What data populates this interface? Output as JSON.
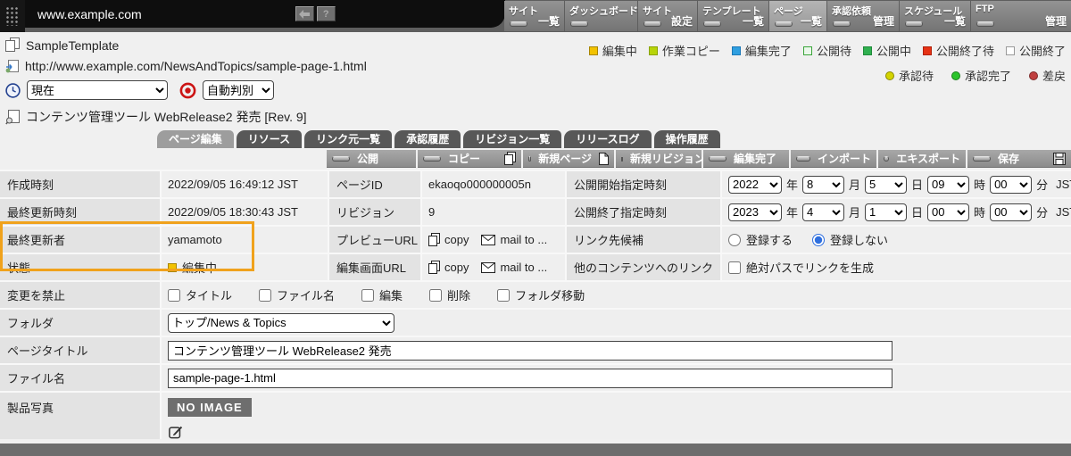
{
  "topbar": {
    "site": "www.example.com",
    "help_label": "?",
    "nav": [
      {
        "top": "サイト",
        "bottom": "一覧"
      },
      {
        "top": "ダッシュボード",
        "bottom": ""
      },
      {
        "top": "サイト",
        "bottom": "設定"
      },
      {
        "top": "テンプレート",
        "bottom": "一覧"
      },
      {
        "top": "ページ",
        "bottom": "一覧"
      },
      {
        "top": "承認依頼",
        "bottom": "管理"
      },
      {
        "top": "スケジュール",
        "bottom": "一覧"
      },
      {
        "top": "FTP",
        "bottom": "管理"
      }
    ]
  },
  "header": {
    "template_name": "SampleTemplate",
    "page_url": "http://www.example.com/NewsAndTopics/sample-page-1.html",
    "revision_select": "現在",
    "render_select": "自動判別",
    "page_heading": "コンテンツ管理ツール WebRelease2 発売 [Rev. 9]"
  },
  "legend": {
    "states": [
      {
        "label": "編集中",
        "fill": "#f2c200",
        "border": "#a88600"
      },
      {
        "label": "作業コピー",
        "fill": "#b8d409",
        "border": "#8aa300"
      },
      {
        "label": "編集完了",
        "fill": "#2f9fe0",
        "border": "#1b78b8"
      },
      {
        "label": "公開待",
        "fill": "#eaf7ea",
        "border": "#3aa53a"
      },
      {
        "label": "公開中",
        "fill": "#30b050",
        "border": "#1f8a3a"
      },
      {
        "label": "公開終了待",
        "fill": "#e63214",
        "border": "#b02008"
      },
      {
        "label": "公開終了",
        "fill": "#ffffff",
        "border": "#9a9a9a"
      }
    ],
    "approvals": [
      {
        "label": "承認待",
        "fill": "#d4d400"
      },
      {
        "label": "承認完了",
        "fill": "#2bc42b"
      },
      {
        "label": "差戻",
        "fill": "#c04040"
      }
    ]
  },
  "tabs": [
    {
      "label": "ページ編集"
    },
    {
      "label": "リソース"
    },
    {
      "label": "リンク元一覧"
    },
    {
      "label": "承認履歴"
    },
    {
      "label": "リビジョン一覧"
    },
    {
      "label": "リリースログ"
    },
    {
      "label": "操作履歴"
    }
  ],
  "toolbar": [
    {
      "label": "公開"
    },
    {
      "label": "コピー"
    },
    {
      "label": "新規ページ"
    },
    {
      "label": "新規リビジョン"
    },
    {
      "label": "編集完了"
    },
    {
      "label": "インポート"
    },
    {
      "label": "エキスポート"
    },
    {
      "label": "保存"
    }
  ],
  "form": {
    "created_label": "作成時刻",
    "created_value": "2022/09/05 16:49:12 JST",
    "pageid_label": "ページID",
    "pageid_value": "ekaoqo000000005n",
    "pub_start_label": "公開開始指定時刻",
    "pub_end_label": "公開終了指定時刻",
    "updated_label": "最終更新時刻",
    "updated_value": "2022/09/05 18:30:43 JST",
    "revision_label": "リビジョン",
    "revision_value": "9",
    "updater_label": "最終更新者",
    "updater_value": "yamamoto",
    "preview_url_label": "プレビューURL",
    "edit_url_label": "編集画面URL",
    "copy_text": "copy",
    "mail_text": "mail to ...",
    "link_cand_label": "リンク先候補",
    "register_yes": "登録する",
    "register_no": "登録しない",
    "status_label": "状態",
    "status_value": "編集中",
    "other_link_label": "他のコンテンツへのリンク",
    "abs_path_label": "絶対パスでリンクを生成",
    "forbid_label": "変更を禁止",
    "forbid_options": [
      "タイトル",
      "ファイル名",
      "編集",
      "削除",
      "フォルダ移動"
    ],
    "folder_label": "フォルダ",
    "folder_value": "トップ/News & Topics",
    "title_label": "ページタイトル",
    "title_value": "コンテンツ管理ツール WebRelease2 発売",
    "filename_label": "ファイル名",
    "filename_value": "sample-page-1.html",
    "photo_label": "製品写真",
    "no_image_text": "NO IMAGE",
    "date_units": {
      "year": "年",
      "month": "月",
      "day": "日",
      "hour": "時",
      "min": "分",
      "tz": "JST"
    },
    "pub_start": {
      "year": "2022",
      "month": "8",
      "day": "5",
      "hour": "09",
      "min": "00"
    },
    "pub_end": {
      "year": "2023",
      "month": "4",
      "day": "1",
      "hour": "00",
      "min": "00"
    }
  },
  "colors": {
    "highlight_border": "#f0a21c",
    "topbar_bg": "#5e5e5e",
    "footer_bg": "#6d6d6d",
    "no_image_bg": "#6e6e6e"
  }
}
